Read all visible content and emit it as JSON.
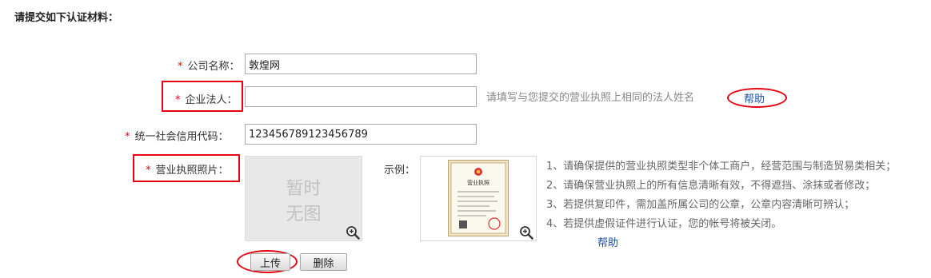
{
  "page": {
    "title": "请提交如下认证材料："
  },
  "required_mark": "*",
  "form": {
    "company_name": {
      "label": "公司名称：",
      "value": "敦煌网"
    },
    "legal_person": {
      "label": "企业法人：",
      "value": "",
      "hint": "请填写与您提交的营业执照上相同的法人姓名",
      "help": "帮助"
    },
    "credit_code": {
      "label": "统一社会信用代码：",
      "value": "123456789123456789"
    },
    "license_photo": {
      "label": "营业执照照片：",
      "placeholder_line1": "暂时",
      "placeholder_line2": "无图"
    }
  },
  "sample": {
    "label": "示例：",
    "license_heading": "营业执照",
    "notes": [
      "1、请确保提供的营业执照类型非个体工商户，经营范围与制造贸易类相关；",
      "2、请确保营业执照上的所有信息清晰有效，不得遮挡、涂抹或者修改；",
      "3、若提供复印件，需加盖所属公司的公章，公章内容清晰可辨认；",
      "4、若提供虚假证件进行认证，您的帐号将被关闭。"
    ],
    "help": "帮助"
  },
  "buttons": {
    "upload": "上传",
    "delete": "删除"
  },
  "colors": {
    "required": "#e60012",
    "highlight": "#e60012",
    "link": "#1a4fa0",
    "hint": "#888888"
  },
  "icons": {
    "zoom": "zoom-in-icon"
  }
}
